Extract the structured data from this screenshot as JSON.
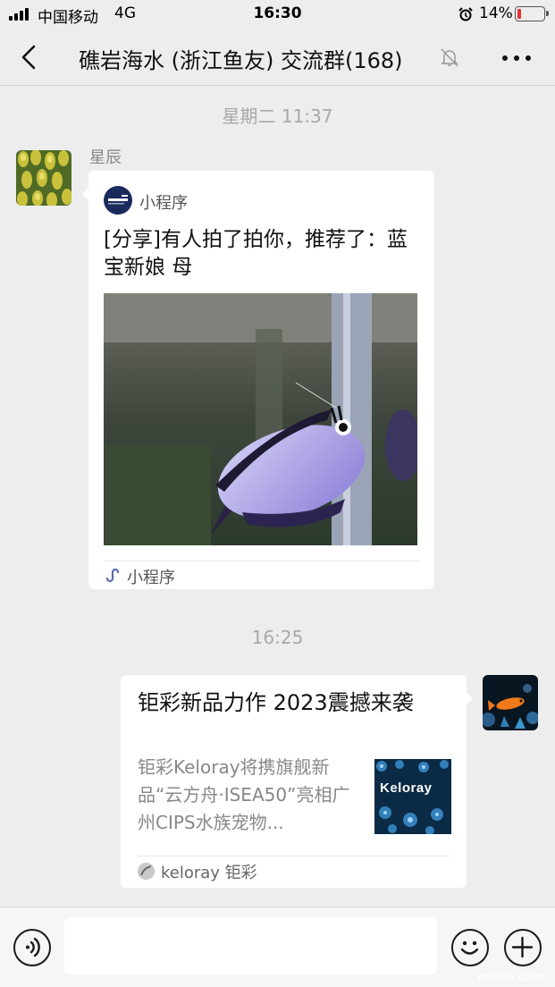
{
  "status_bar": {
    "carrier": "中国移动",
    "network": "4G",
    "time": "16:30",
    "battery": "14%",
    "battery_level": 0.14,
    "battery_color": "#e33333"
  },
  "nav": {
    "title": "礁岩海水 (浙江鱼友) 交流群(168)",
    "back_icon": "chevron-left-icon",
    "mute_icon": "bell-muted-icon",
    "more_icon": "more-dots-icon"
  },
  "messages": [
    {
      "timestamp": "星期二 11:37",
      "sender": "星辰",
      "card": {
        "type": "mini-program",
        "app_label": "小程序",
        "title": "[分享]有人拍了拍你，推荐了：蓝宝新娘 母",
        "footer": "小程序",
        "image_alt": "purple angelfish photo"
      }
    },
    {
      "timestamp": "16:25",
      "sender": "self",
      "card": {
        "type": "article",
        "title": "钜彩新品力作 2023震撼来袭",
        "description": "钜彩Keloray将携旗舰新品“云方舟·ISEA50”亮相广州CIPS水族宠物...",
        "thumb_text": "Keloray",
        "source": "keloray 钜彩"
      }
    }
  ],
  "input_bar": {
    "placeholder": "",
    "voice_icon": "voice-icon",
    "emoji_icon": "emoji-icon",
    "plus_icon": "plus-icon"
  },
  "watermark": "cnfish.com",
  "colors": {
    "background": "#ededed",
    "bubble": "#ffffff",
    "timestamp": "#a8a8a8"
  }
}
